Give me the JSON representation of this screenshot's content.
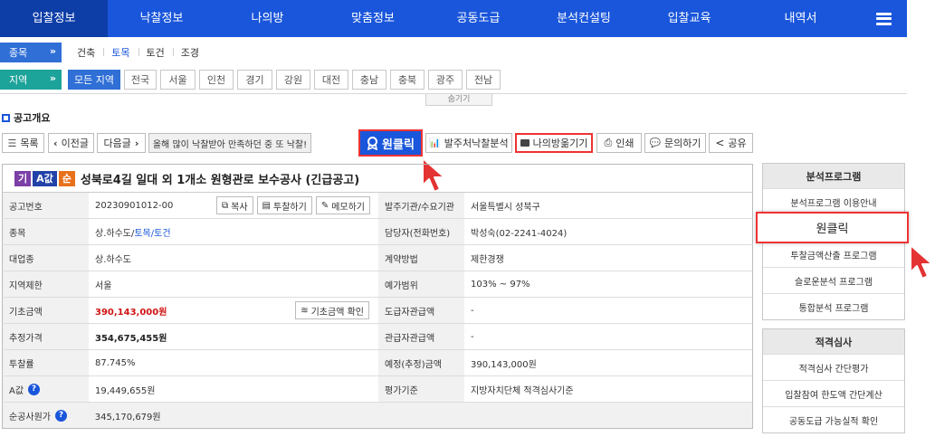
{
  "nav": {
    "items": [
      "입찰정보",
      "낙찰정보",
      "나의방",
      "맞춤정보",
      "공동도급",
      "분석컨설팅",
      "입찰교육",
      "내역서"
    ],
    "active_index": 0
  },
  "filters": {
    "category_label": "종목",
    "categories": [
      "건축",
      "토목",
      "토건",
      "조경"
    ],
    "selected_category": "토목",
    "region_label": "지역",
    "regions": [
      "모든 지역",
      "전국",
      "서울",
      "인천",
      "경기",
      "강원",
      "대전",
      "충남",
      "충북",
      "광주",
      "전남"
    ],
    "selected_region": "모든 지역",
    "hide_label": "숨기기"
  },
  "section_title": "공고개요",
  "toolbar": {
    "list": "목록",
    "prev": "이전글",
    "next": "다음글",
    "promo": "올해 많이 낙찰받아 만족하던 중 또 낙찰!",
    "one_click": "원클릭",
    "award_analysis": "발주처낙찰분석",
    "save_my_room": "나의방옮기기",
    "print": "인쇄",
    "inquiry": "문의하기",
    "share": "공유"
  },
  "notice": {
    "tags": [
      "기",
      "A값",
      "순"
    ],
    "title": "성북로4길 일대 외 1개소 원형관로 보수공사 (긴급공고)"
  },
  "buttons": {
    "copy": "복사",
    "bid": "투찰하기",
    "memo": "메모하기",
    "base_check": "기초금액 확인"
  },
  "rows": [
    {
      "k": "공고번호",
      "v": "20230901012-00",
      "k2": "발주기관/수요기관",
      "v2": "서울특별시 성북구"
    },
    {
      "k": "종목",
      "v_prefix": "상.하수도/",
      "v_link": "토목/토건",
      "k2": "담당자(전화번호)",
      "v2": "박성숙(02-2241-4024)"
    },
    {
      "k": "대업종",
      "v": "상.하수도",
      "k2": "계약방법",
      "v2": "제한경쟁"
    },
    {
      "k": "지역제한",
      "v": "서울",
      "k2": "예가범위",
      "v2": "103% ~ 97%"
    },
    {
      "k": "기초금액",
      "v": "390,143,000원",
      "k2": "도급자관급액",
      "v2": "-"
    },
    {
      "k": "추정가격",
      "v": "354,675,455원",
      "k2": "관급자관급액",
      "v2": "-"
    },
    {
      "k": "투찰률",
      "v": "87.745%",
      "k2": "예정(추정)금액",
      "v2": "390,143,000원"
    },
    {
      "k": "A값",
      "v": "19,449,655원",
      "k2": "평가기준",
      "v2": "지방자치단체 적격심사기준"
    },
    {
      "k": "순공사원가",
      "v": "345,170,679원"
    }
  ],
  "right_panel": {
    "analysis_head": "분석프로그램",
    "analysis_items": [
      "분석프로그램 이용안내",
      "원클릭",
      "투찰금액산출 프로그램",
      "슬로운분석 프로그램",
      "통합분석 프로그램"
    ],
    "eligibility_head": "적격심사",
    "eligibility_items": [
      "적격심사 간단평가",
      "입찰참여 한도액 간단계산",
      "공동도급 가능실적 확인"
    ]
  },
  "colors": {
    "brand": "#1a56db",
    "highlight_border": "#e33333",
    "price_red": "#d01414"
  }
}
